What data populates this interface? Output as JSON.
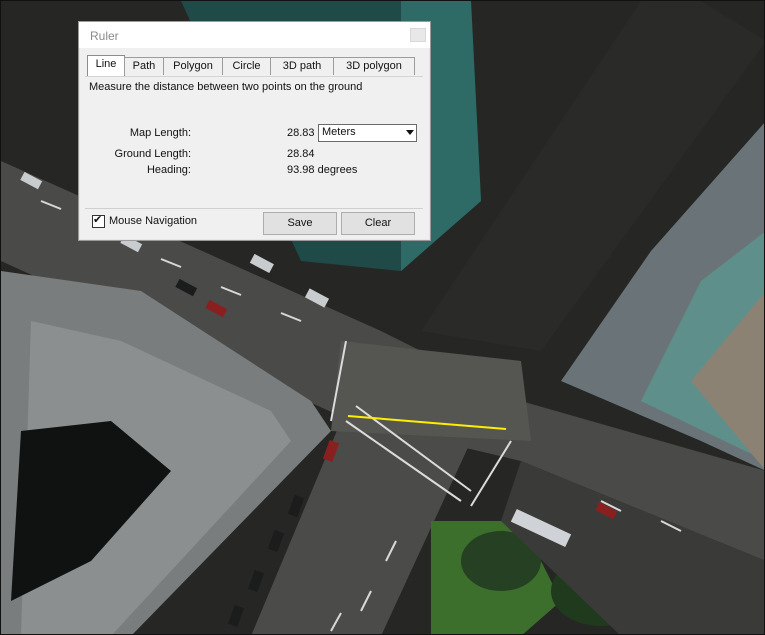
{
  "map": {
    "measure_line_color": "#ffee00",
    "colors": {
      "road": "#4a4a48",
      "roof": "#7a7d7e",
      "glass": "#1f4a47",
      "green": "#3c6e2c"
    }
  },
  "ruler": {
    "title": "Ruler",
    "tabs": [
      "Line",
      "Path",
      "Polygon",
      "Circle",
      "3D path",
      "3D polygon"
    ],
    "active_tab": "Line",
    "description": "Measure the distance between two points on the ground",
    "map_length_label": "Map Length:",
    "map_length_value": "28.83",
    "unit_select": "Meters",
    "ground_length_label": "Ground Length:",
    "ground_length_value": "28.84",
    "heading_label": "Heading:",
    "heading_value": "93.98 degrees",
    "mouse_navigation_label": "Mouse Navigation",
    "mouse_navigation_checked": true,
    "save_label": "Save",
    "clear_label": "Clear"
  }
}
